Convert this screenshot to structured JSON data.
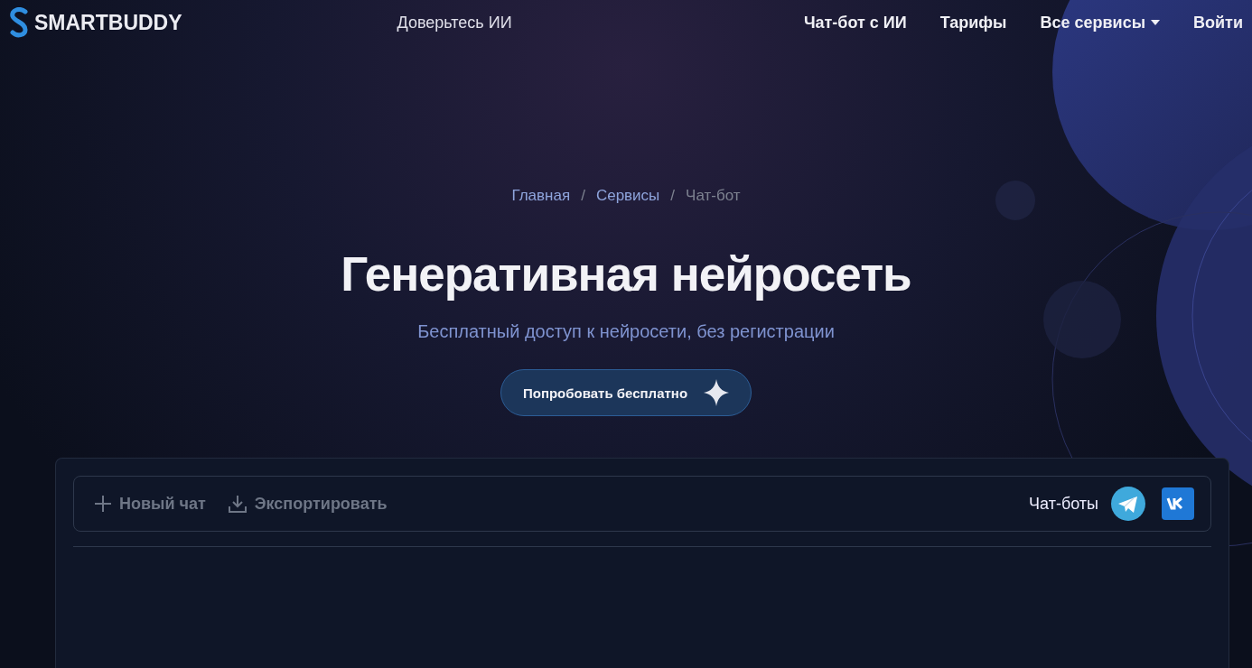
{
  "brand": {
    "name": "SMARTBUDDY"
  },
  "tagline": "Доверьтесь ИИ",
  "nav": [
    {
      "label": "Чат-бот с ИИ",
      "dropdown": false
    },
    {
      "label": "Тарифы",
      "dropdown": false
    },
    {
      "label": "Все сервисы",
      "dropdown": true
    },
    {
      "label": "Войти",
      "dropdown": false
    }
  ],
  "breadcrumbs": [
    {
      "label": "Главная",
      "current": false
    },
    {
      "label": "Сервисы",
      "current": false
    },
    {
      "label": "Чат-бот",
      "current": true
    }
  ],
  "breadcrumb_separator": "/",
  "hero": {
    "title": "Генеративная нейросеть",
    "subtitle": "Бесплатный доступ к нейросети, без регистрации",
    "button": "Попробовать бесплатно"
  },
  "chat": {
    "toolbar": [
      {
        "label": "Новый чат",
        "kind": "new"
      },
      {
        "label": "Экспортировать",
        "kind": "export"
      }
    ],
    "bots_label": "Чат-боты"
  }
}
